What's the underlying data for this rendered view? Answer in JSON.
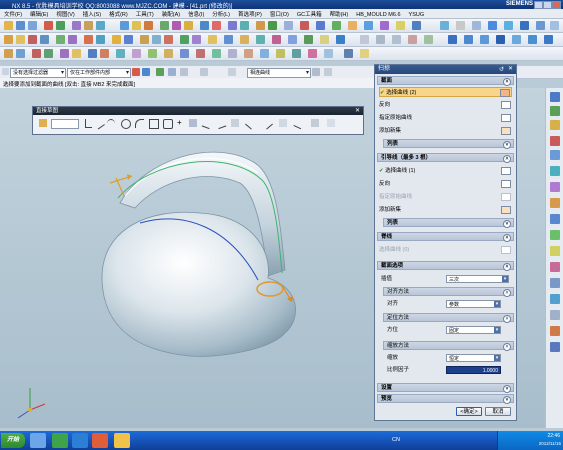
{
  "window": {
    "title": "NX 8.5 - 优胜模具培训学校  QQ:8003088  www.MJZC.COM - 建模 - [41.prt (修改的)]",
    "brand": "SIEMENS"
  },
  "menu": [
    "文件(F)",
    "编辑(E)",
    "视图(V)",
    "插入(S)",
    "格式(R)",
    "工具(T)",
    "装配(A)",
    "信息(I)",
    "分析(L)",
    "首选项(P)",
    "窗口(O)",
    "GC工具箱",
    "帮助(H)",
    "HB_MOULD M6.6",
    "YSUG"
  ],
  "selection_bar": {
    "filter": "没有选择过滤器",
    "scope": "仅在工作部件内部",
    "curve_rule": "相连曲线"
  },
  "cue_line": "选择要添加到截面的曲线 [双击: 直接 MB2 来完成截面]",
  "curve_dialog": {
    "title": "直接草图"
  },
  "panel": {
    "title": "扫掠",
    "sections": {
      "section": "截面",
      "guide": "引导线（最多 3 根）",
      "spine": "脊线",
      "section_options": "截面选项",
      "settings": "设置",
      "preview": "预览"
    },
    "section_rows": {
      "select_curve": "选择曲线 (2)",
      "reverse": "反向",
      "origin": "指定原始曲线",
      "add_new": "添加新集",
      "list": "列表"
    },
    "guide_rows": {
      "select_curve": "选择曲线 (1)",
      "reverse": "反向",
      "origin": "指定原始曲线",
      "add_new": "添加新集",
      "list": "列表"
    },
    "spine_row": "选择曲线 (0)",
    "section_location_label": "插值",
    "section_location_value": "三次",
    "alignment_group": "对齐方法",
    "alignment_label": "对齐",
    "alignment_value": "参数",
    "orientation_group": "定位方法",
    "orientation_label": "方位",
    "orientation_value": "固定",
    "scaling_group": "缩放方法",
    "scaling_label": "缩放",
    "scaling_value": "恒定",
    "ratio_label": "比例因子",
    "ratio_value": "1.0000",
    "ok": "<确定>",
    "cancel": "取消"
  },
  "taskbar": {
    "start": "开始",
    "lang": "CN",
    "time": "22:46",
    "date": "2012/11/15"
  }
}
